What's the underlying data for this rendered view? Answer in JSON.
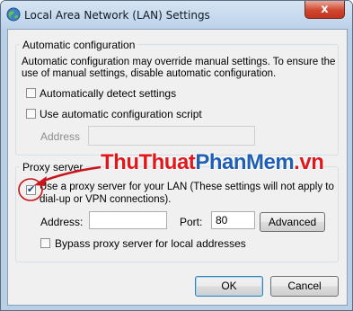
{
  "window": {
    "title": "Local Area Network (LAN) Settings",
    "close_label": "x"
  },
  "auto_config": {
    "group_label": "Automatic configuration",
    "description": "Automatic configuration may override manual settings.  To ensure the use of manual settings, disable automatic configuration.",
    "detect_label": "Automatically detect settings",
    "detect_checked": false,
    "script_label": "Use automatic configuration script",
    "script_checked": false,
    "address_label": "Address",
    "address_value": ""
  },
  "proxy": {
    "group_label": "Proxy server",
    "use_proxy_label_line1": "Use a proxy server for your LAN (These settings will not apply to",
    "use_proxy_label_line2": "dial-up or VPN connections).",
    "use_proxy_checked": true,
    "address_label": "Address:",
    "address_value": "",
    "port_label": "Port:",
    "port_value": "80",
    "advanced_label": "Advanced",
    "bypass_label": "Bypass proxy server for local addresses",
    "bypass_checked": false
  },
  "buttons": {
    "ok_label": "OK",
    "cancel_label": "Cancel"
  },
  "watermark": {
    "part1": "ThuThuat",
    "part2": "PhanMem",
    "part3": ".vn"
  },
  "colors": {
    "accent_red": "#e0181b",
    "accent_blue": "#1f5fb4",
    "title_bar": "#bcd2ea"
  }
}
